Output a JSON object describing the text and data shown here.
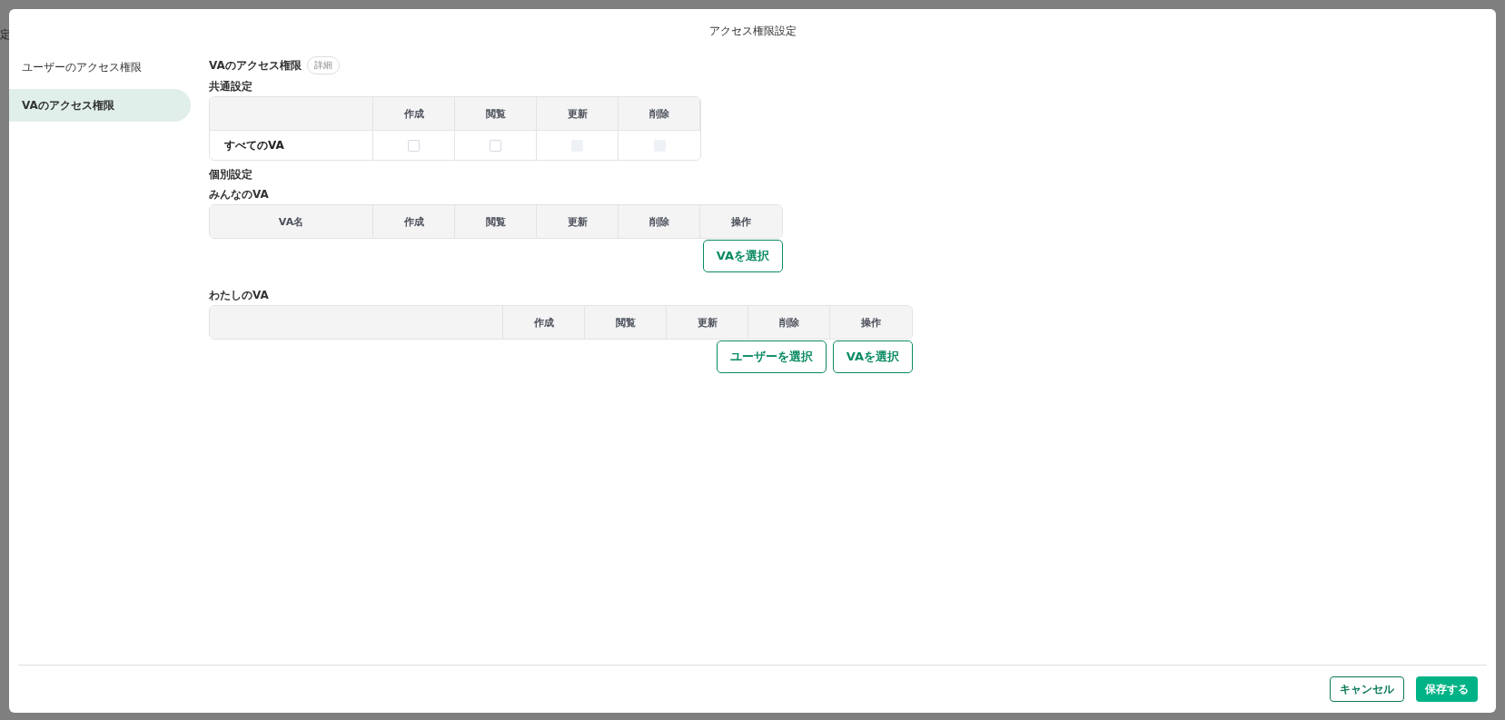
{
  "background_page": {
    "label": "定"
  },
  "dialog": {
    "title": "アクセス権限設定"
  },
  "sidebar": {
    "items": [
      {
        "label": "ユーザーのアクセス権限",
        "selected": false
      },
      {
        "label": "VAのアクセス権限",
        "selected": true
      }
    ]
  },
  "section": {
    "title": "VAのアクセス権限",
    "detail_button": "詳細"
  },
  "common": {
    "title": "共通設定",
    "columns": [
      "",
      "作成",
      "閲覧",
      "更新",
      "削除"
    ],
    "rows": [
      {
        "name": "すべてのVA",
        "cells": [
          {
            "checked": false,
            "disabled": false
          },
          {
            "checked": false,
            "disabled": false
          },
          {
            "checked": false,
            "disabled": true
          },
          {
            "checked": false,
            "disabled": true
          }
        ]
      }
    ]
  },
  "individual": {
    "title": "個別設定",
    "groups": [
      {
        "title": "みんなのVA",
        "wide_first": false,
        "columns": [
          "VA名",
          "作成",
          "閲覧",
          "更新",
          "削除",
          "操作"
        ],
        "buttons": [
          "VAを選択"
        ]
      },
      {
        "title": "わたしのVA",
        "wide_first": true,
        "columns": [
          "",
          "作成",
          "閲覧",
          "更新",
          "削除",
          "操作"
        ],
        "buttons": [
          "ユーザーを選択",
          "VAを選択"
        ]
      }
    ]
  },
  "footer": {
    "cancel": "キャンセル",
    "save": "保存する"
  }
}
